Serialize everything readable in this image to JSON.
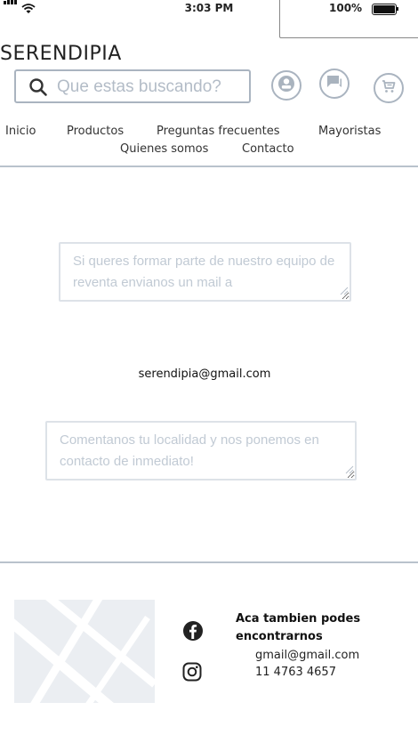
{
  "status": {
    "time": "3:03 PM",
    "battery": "100%",
    "battery_level": 1.0
  },
  "logo": "SERENDIPIA",
  "search": {
    "placeholder": "Que estas buscando?"
  },
  "header_icons": [
    "user-icon",
    "chat-icon",
    "cart-icon"
  ],
  "nav": {
    "items": [
      "Inicio",
      "Productos",
      "Preguntas frecuentes",
      "Mayoristas",
      "Quienes somos",
      "Contacto"
    ]
  },
  "main": {
    "textbox1_placeholder": "Si queres formar parte de nuestro equipo de reventa envianos un mail a",
    "email": "serendipia@gmail.com",
    "textbox2_placeholder": "Comentanos tu localidad y nos ponemos en contacto de inmediato!"
  },
  "footer": {
    "heading": "Aca tambien podes encontrarnos",
    "email": "gmail@gmail.com",
    "phone": "11 4763 4657",
    "social_icons": [
      "facebook-icon",
      "instagram-icon"
    ]
  },
  "colors": {
    "border": "#aab4c0",
    "rule": "#b9c2cc",
    "placeholder": "#c1cad4",
    "map_bg": "#ebeef2"
  }
}
